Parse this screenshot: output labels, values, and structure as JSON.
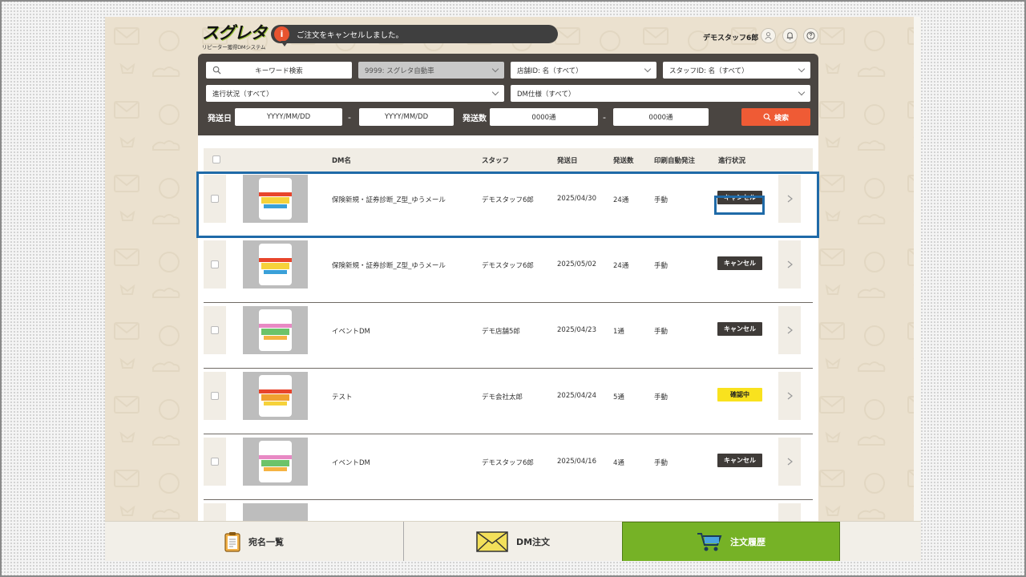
{
  "header": {
    "logo_main": "スグレタ",
    "logo_sub": "リピーター獲得DMシステム",
    "toast_icon": "i",
    "toast_message": "ご注文をキャンセルしました。",
    "user_name": "デモスタッフ6郎"
  },
  "filters": {
    "keyword_placeholder": "キーワード検索",
    "company": "9999: スグレタ自動車",
    "store": "店舗ID: 名（すべて）",
    "staff": "スタッフID: 名（すべて）",
    "progress": "進行状況（すべて）",
    "dm_spec": "DM仕様（すべて）",
    "ship_date_label": "発送日",
    "date_from_placeholder": "YYYY/MM/DD",
    "date_sep": "-",
    "date_to_placeholder": "YYYY/MM/DD",
    "count_label": "発送数",
    "count_from_placeholder": "0000通",
    "count_sep": "-",
    "count_to_placeholder": "0000通",
    "search_button": "検索"
  },
  "table": {
    "headers": {
      "dm_name": "DM名",
      "staff": "スタッフ",
      "ship_date": "発送日",
      "ship_count": "発送数",
      "auto_print": "印刷自動発注",
      "status": "進行状況"
    },
    "rows": [
      {
        "dm_name": "保険新規・証券診断_Z型_ゆうメール",
        "staff": "デモスタッフ6郎",
        "ship_date": "2025/04/30",
        "ship_count": "24通",
        "auto_print": "手動",
        "status": "キャンセル",
        "status_type": "cancel"
      },
      {
        "dm_name": "保険新規・証券診断_Z型_ゆうメール",
        "staff": "デモスタッフ6郎",
        "ship_date": "2025/05/02",
        "ship_count": "24通",
        "auto_print": "手動",
        "status": "キャンセル",
        "status_type": "cancel"
      },
      {
        "dm_name": "イベントDM",
        "staff": "デモ店舗5郎",
        "ship_date": "2025/04/23",
        "ship_count": "1通",
        "auto_print": "手動",
        "status": "キャンセル",
        "status_type": "cancel"
      },
      {
        "dm_name": "テスト",
        "staff": "デモ会社太郎",
        "ship_date": "2025/04/24",
        "ship_count": "5通",
        "auto_print": "手動",
        "status": "確認中",
        "status_type": "confirm"
      },
      {
        "dm_name": "イベントDM",
        "staff": "デモスタッフ6郎",
        "ship_date": "2025/04/16",
        "ship_count": "4通",
        "auto_print": "手動",
        "status": "キャンセル",
        "status_type": "cancel"
      }
    ]
  },
  "nav": {
    "tabs": [
      {
        "label": "宛名一覧",
        "icon": "clipboard-icon"
      },
      {
        "label": "DM注文",
        "icon": "envelope-icon"
      },
      {
        "label": "注文履歴",
        "icon": "cart-icon"
      }
    ],
    "active": "注文履歴"
  },
  "colors": {
    "accent_green": "#76b226",
    "search_orange": "#ef5b35",
    "highlight_blue": "#1f6aa8",
    "status_confirm": "#f9e21e",
    "status_cancel": "#3f3b38"
  }
}
